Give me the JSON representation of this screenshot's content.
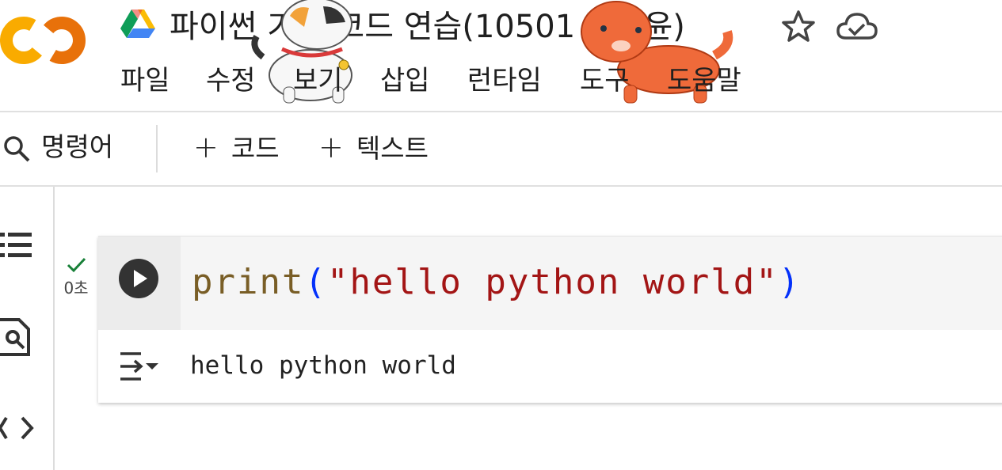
{
  "app": {
    "logo_text": "CO",
    "notebook_title": "파이썬 기초 코드 연습(10501 장재윤)",
    "colors": {
      "logo_orange": "#F9AB00",
      "logo_dark_orange": "#E8710A",
      "accent_blue": "#1a73e8"
    }
  },
  "header_icons": [
    "google-drive-icon",
    "star-icon",
    "cloud-saved-icon"
  ],
  "menu": [
    "파일",
    "수정",
    "보기",
    "삽입",
    "런타임",
    "도구",
    "도움말"
  ],
  "toolbar": {
    "search_label": "명령어",
    "add_code_label": "코드",
    "add_text_label": "텍스트"
  },
  "sidebar_icons": [
    "table-of-contents-icon",
    "find-icon",
    "code-snippets-icon"
  ],
  "cell": {
    "exec_status": "✓",
    "exec_time": "0초",
    "code_tokens": {
      "fn": "print",
      "open": "(",
      "str": "\"hello python world\"",
      "close": ")"
    },
    "output": "hello python world"
  }
}
